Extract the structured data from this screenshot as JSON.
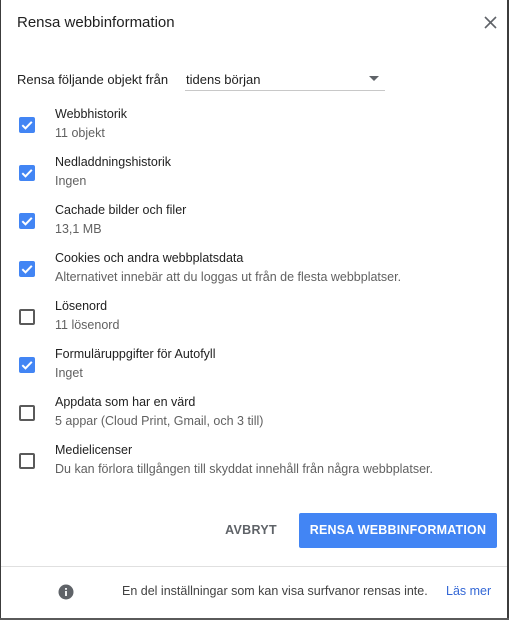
{
  "dialog": {
    "title": "Rensa webbinformation"
  },
  "time_range": {
    "label": "Rensa följande objekt från",
    "selected": "tidens början"
  },
  "items": [
    {
      "title": "Webbhistorik",
      "subtitle": "11 objekt",
      "checked": true
    },
    {
      "title": "Nedladdningshistorik",
      "subtitle": "Ingen",
      "checked": true
    },
    {
      "title": "Cachade bilder och filer",
      "subtitle": "13,1 MB",
      "checked": true
    },
    {
      "title": "Cookies och andra webbplatsdata",
      "subtitle": "Alternativet innebär att du loggas ut från de flesta webbplatser.",
      "checked": true
    },
    {
      "title": "Lösenord",
      "subtitle": "11 lösenord",
      "checked": false
    },
    {
      "title": "Formuläruppgifter för Autofyll",
      "subtitle": "Inget",
      "checked": true
    },
    {
      "title": "Appdata som har en värd",
      "subtitle": "5 appar (Cloud Print, Gmail, och 3 till)",
      "checked": false
    },
    {
      "title": "Medielicenser",
      "subtitle": "Du kan förlora tillgången till skyddat innehåll från några webbplatser.",
      "checked": false
    }
  ],
  "buttons": {
    "cancel": "AVBRYT",
    "clear": "RENSA WEBBINFORMATION"
  },
  "footer": {
    "text": "En del inställningar som kan visa surfvanor rensas inte.",
    "link": "Läs mer"
  },
  "colors": {
    "accent": "#4285f4",
    "link": "#3367d6"
  }
}
